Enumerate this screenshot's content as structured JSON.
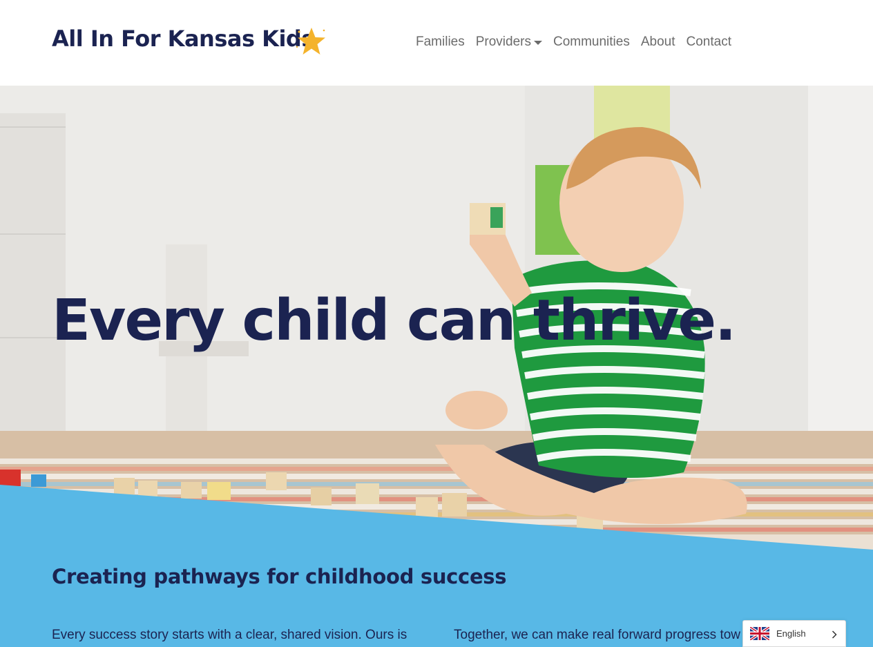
{
  "header": {
    "logo_text": "All In For Kansas Kids",
    "nav": [
      {
        "label": "Families"
      },
      {
        "label": "Providers",
        "has_dropdown": true
      },
      {
        "label": "Communities"
      },
      {
        "label": "About"
      },
      {
        "label": "Contact"
      }
    ]
  },
  "hero": {
    "title": "Every child can thrive."
  },
  "section": {
    "title": "Creating pathways for childhood success",
    "left_paragraph": "Every success story starts with a clear, shared vision. Ours is",
    "right_paragraph": "Together, we can make real forward progress tow"
  },
  "language_switcher": {
    "label": "English",
    "flag_icon": "uk-flag-icon"
  },
  "colors": {
    "navy": "#1b2351",
    "band_blue": "#58b8e6",
    "star": "#f4b32c",
    "nav_gray": "#6b6b6b"
  }
}
